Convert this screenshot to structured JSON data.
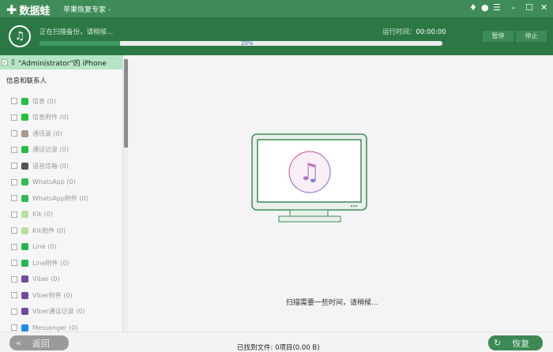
{
  "titlebar": {
    "logo": "数据蛙",
    "title": "苹果恢复专家 -",
    "icons": [
      "diamond-icon",
      "chat-icon",
      "feedback-icon",
      "minimize-icon",
      "maximize-icon",
      "close-icon"
    ]
  },
  "header": {
    "status": "正在扫描备份，请稍候...",
    "progress_percent": 20,
    "progress_label": "20%",
    "runtime_label": "运行时间：",
    "runtime_value": "00:00:00",
    "pause": "暂停",
    "stop": "停止"
  },
  "sidebar": {
    "device": "\"Administrator\"的 iPhone",
    "group": "信息和联系人",
    "items": [
      {
        "label": "信息 (0)",
        "color": "#22c23a"
      },
      {
        "label": "信息附件 (0)",
        "color": "#22c23a"
      },
      {
        "label": "通讯录 (0)",
        "color": "#a89a8a"
      },
      {
        "label": "通话记录 (0)",
        "color": "#22c23a"
      },
      {
        "label": "语音信箱 (0)",
        "color": "#555555"
      },
      {
        "label": "WhatsApp (0)",
        "color": "#2fbe4e"
      },
      {
        "label": "WhatsApp附件 (0)",
        "color": "#2fbe4e"
      },
      {
        "label": "Kik (0)",
        "color": "#b8e0a0"
      },
      {
        "label": "Kik附件 (0)",
        "color": "#b8e0a0"
      },
      {
        "label": "Line (0)",
        "color": "#22b84a"
      },
      {
        "label": "Line附件 (0)",
        "color": "#22b84a"
      },
      {
        "label": "Viber (0)",
        "color": "#6e4a9e"
      },
      {
        "label": "Viber附件 (0)",
        "color": "#6e4a9e"
      },
      {
        "label": "Viber通话记录 (0)",
        "color": "#6e4a9e"
      },
      {
        "label": "Messenger (0)",
        "color": "#1e88f0"
      }
    ]
  },
  "main": {
    "wait": "扫描需要一些时间，请稍候..."
  },
  "footer": {
    "back": "返回",
    "found": "已找到文件: 0项目(0.00 B)",
    "recover": "恢复"
  }
}
